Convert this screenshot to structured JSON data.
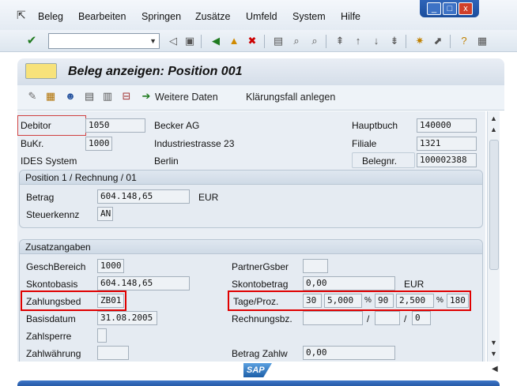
{
  "menu": [
    "Beleg",
    "Bearbeiten",
    "Springen",
    "Zusätze",
    "Umfeld",
    "System",
    "Hilfe"
  ],
  "window_controls": [
    "_",
    "□",
    "x"
  ],
  "title": "Beleg anzeigen: Position 001",
  "app_toolbar": {
    "weitere_daten": "Weitere Daten",
    "klaerungsfall": "Klärungsfall anlegen"
  },
  "header": {
    "debitor_label": "Debitor",
    "debitor": "1050",
    "debitor_name": "Becker AG",
    "bukr_label": "BuKr.",
    "bukr": "1000",
    "street": "Industriestrasse 23",
    "company": "IDES System",
    "city": "Berlin",
    "hauptbuch_label": "Hauptbuch",
    "hauptbuch": "140000",
    "filiale_label": "Filiale",
    "filiale": "1321",
    "belegnr_label": "Belegnr.",
    "belegnr": "100002388"
  },
  "position": {
    "header": "Position 1 / Rechnung / 01",
    "betrag_label": "Betrag",
    "betrag": "604.148,65",
    "currency": "EUR",
    "steuerkennz_label": "Steuerkennz",
    "steuerkennz": "AN"
  },
  "zusatz": {
    "header": "Zusatzangaben",
    "geschbereich_label": "GeschBereich",
    "geschbereich": "1000",
    "partnergsber_label": "PartnerGsber",
    "partnergsber": "",
    "skontobasis_label": "Skontobasis",
    "skontobasis": "604.148,65",
    "skontobetrag_label": "Skontobetrag",
    "skontobetrag": "0,00",
    "skontobetrag_currency": "EUR",
    "zahlungsbed_label": "Zahlungsbed",
    "zahlungsbed": "ZB01",
    "tage_proz_label": "Tage/Proz.",
    "tage1": "30",
    "proz1": "5,000",
    "tage2": "90",
    "proz2": "2,500",
    "tage3": "180",
    "pct": "%",
    "basisdatum_label": "Basisdatum",
    "basisdatum": "31.08.2005",
    "rechnungsbz_label": "Rechnungsbz.",
    "rechnungsbz_sep": "/",
    "rechnungsbz_val": "0",
    "zahlsperre_label": "Zahlsperre",
    "zahlwaehrung_label": "Zahlwährung",
    "betrag_zahlw_label": "Betrag Zahlw",
    "betrag_zahlw": "0,00"
  },
  "footer": {
    "logo": "SAP"
  },
  "colors": {
    "highlight": "#e00000",
    "statusbar": "#1e4f9a"
  }
}
